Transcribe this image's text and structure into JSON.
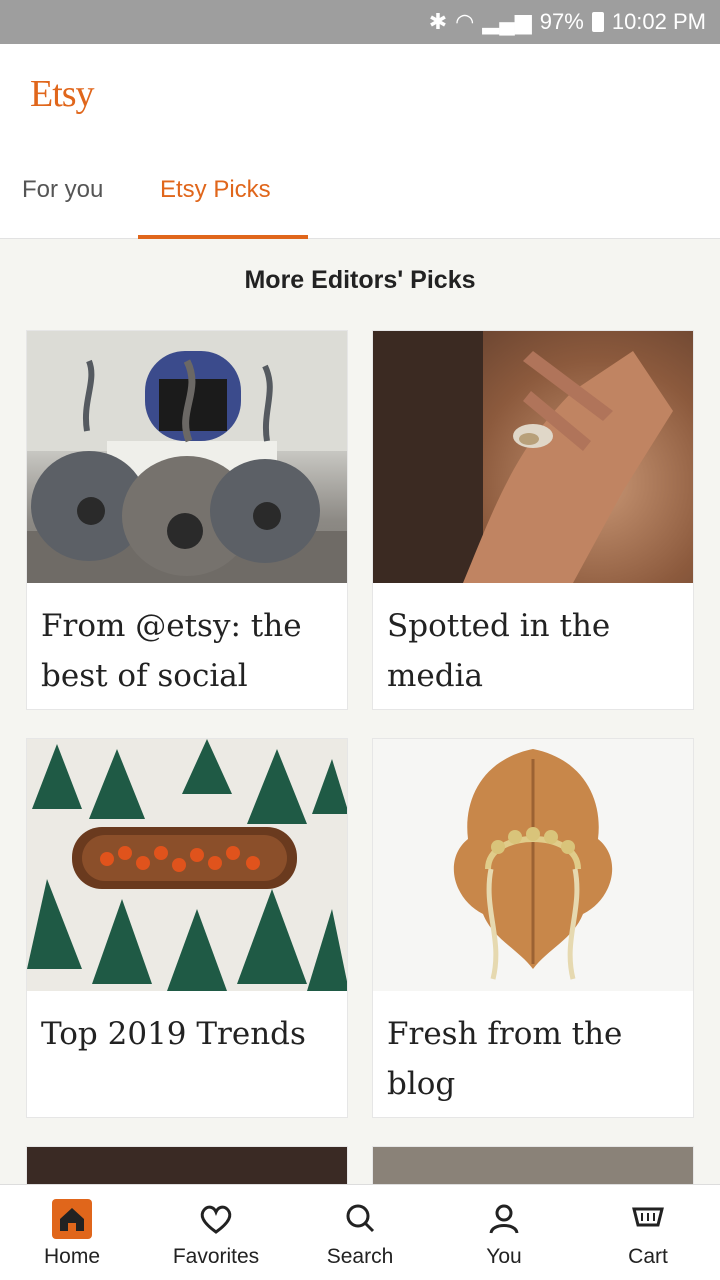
{
  "status_bar": {
    "battery": "97%",
    "time": "10:02 PM"
  },
  "header": {
    "logo": "Etsy",
    "tabs": [
      {
        "label": "For you",
        "active": false
      },
      {
        "label": "Etsy Picks",
        "active": true
      }
    ]
  },
  "section": {
    "title": "More Editors' Picks"
  },
  "cards": [
    {
      "caption_line1": "From @etsy: the",
      "caption_line2": "best of social",
      "image": "felt-cat-caves"
    },
    {
      "caption_line1": "Spotted in the",
      "caption_line2": "media",
      "image": "hand-with-ring"
    },
    {
      "caption_line1": "Top 2019 Trends",
      "caption_line2": "",
      "image": "wooden-tray-oranges"
    },
    {
      "caption_line1": "Fresh from the",
      "caption_line2": "blog",
      "image": "leaf-headpiece"
    }
  ],
  "bottom_nav": {
    "items": [
      {
        "label": "Home",
        "icon": "home-icon",
        "active": true
      },
      {
        "label": "Favorites",
        "icon": "heart-icon",
        "active": false
      },
      {
        "label": "Search",
        "icon": "search-icon",
        "active": false
      },
      {
        "label": "You",
        "icon": "person-icon",
        "active": false
      },
      {
        "label": "Cart",
        "icon": "cart-icon",
        "active": false
      }
    ]
  },
  "colors": {
    "accent": "#e0661b",
    "background": "#f5f5f1",
    "status_bar": "#9e9e9e"
  }
}
